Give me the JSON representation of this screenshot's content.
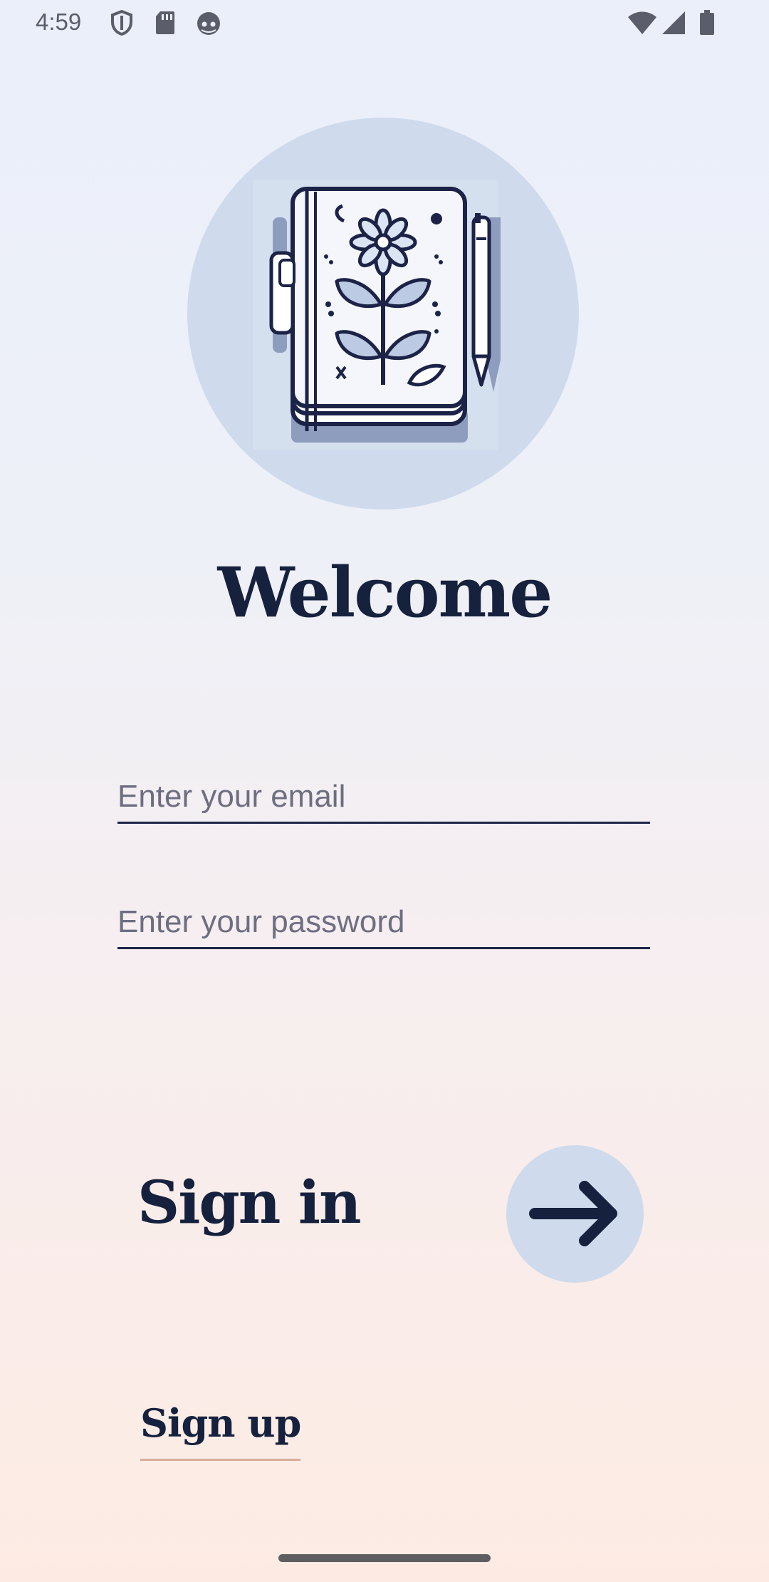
{
  "status_bar": {
    "time": "4:59",
    "left_icons": [
      "shield-icon",
      "sd-card-icon",
      "android-robot-icon"
    ],
    "right_icons": [
      "wifi-icon",
      "signal-icon",
      "battery-icon"
    ]
  },
  "hero": {
    "image": "notebook-flower-pen-illustration"
  },
  "title": "Welcome",
  "form": {
    "email_placeholder": "Enter your email",
    "email_value": "",
    "password_placeholder": "Enter your password",
    "password_value": ""
  },
  "signin": {
    "label": "Sign in",
    "button_icon": "arrow-right-icon"
  },
  "signup": {
    "label": "Sign up"
  },
  "colors": {
    "primary": "#16213e",
    "circle": "#cfdbec",
    "underline_accent": "#d8ad98",
    "field_line": "#1c2347"
  }
}
